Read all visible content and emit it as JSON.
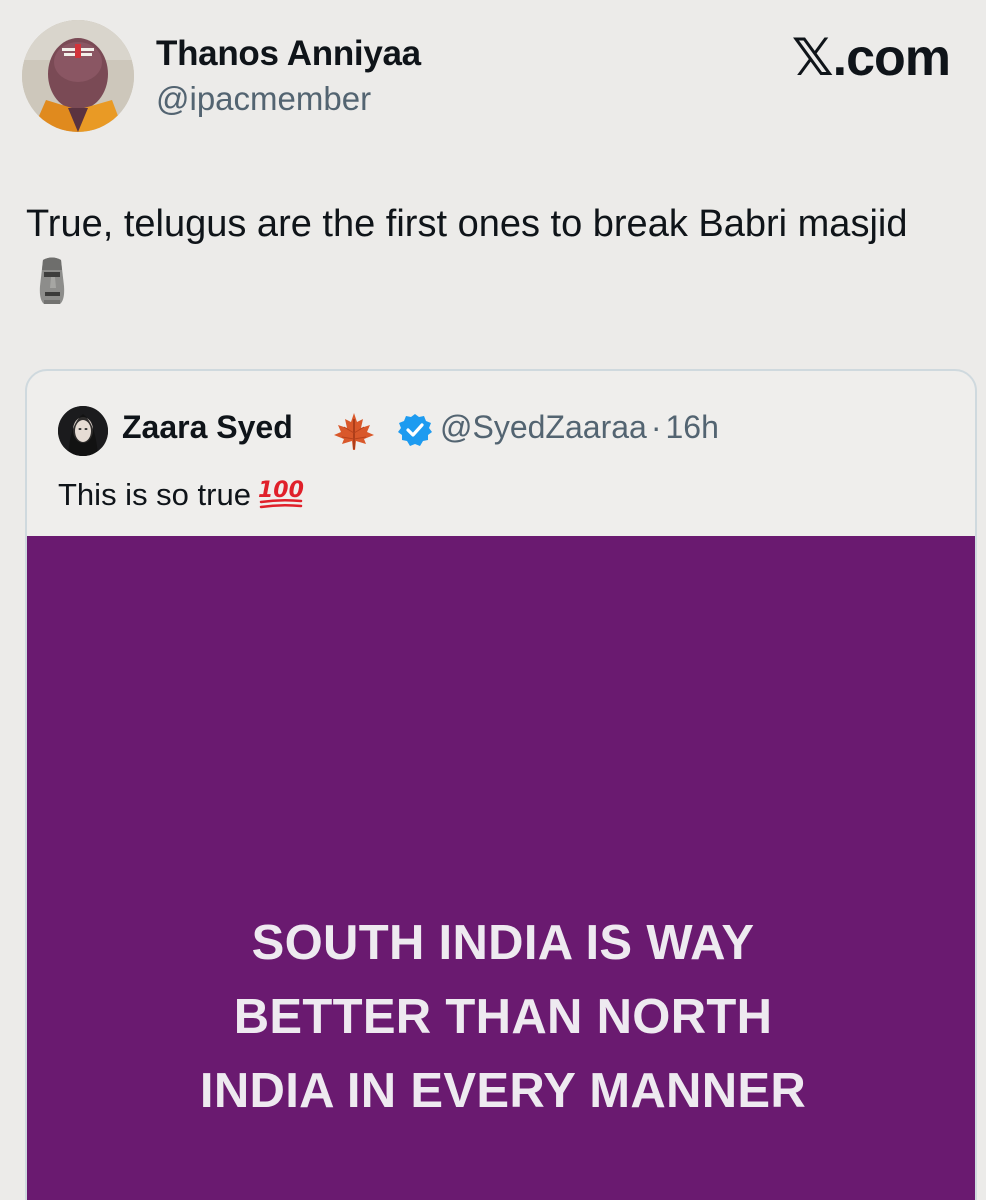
{
  "tweet": {
    "display_name": "Thanos Anniyaa",
    "handle": "@ipacmember",
    "brand_x": "𝕏",
    "brand_domain": ".com",
    "text": "True, telugus are the first ones to break Babri masjid",
    "text_emoji": "moai-icon"
  },
  "quoted_tweet": {
    "display_name": "Zaara Syed",
    "handle": "@SyedZaaraa",
    "separator": "·",
    "timestamp": "16h",
    "text": "This is so true",
    "text_emoji": "hundred-points-icon",
    "name_icons": [
      "maple-leaf-icon",
      "verified-badge-icon"
    ],
    "media": {
      "background": "#6a1a70",
      "caption_lines": [
        "SOUTH INDIA IS WAY",
        "BETTER THAN NORTH",
        "INDIA IN EVERY MANNER"
      ]
    }
  },
  "colors": {
    "background": "#ecebe9",
    "verified_blue": "#1d9bf0",
    "secondary_text": "#536471"
  }
}
